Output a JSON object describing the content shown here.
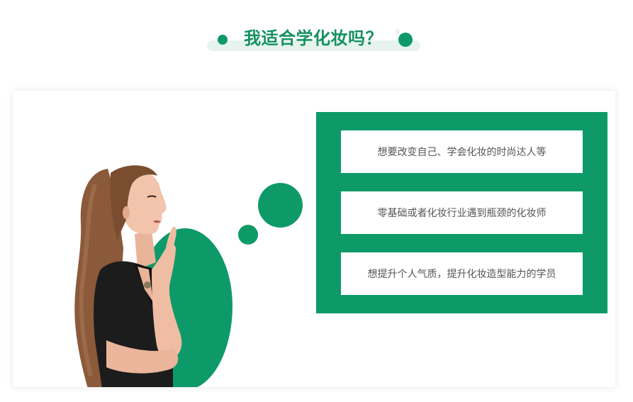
{
  "heading": {
    "title": "我适合学化妆吗？"
  },
  "colors": {
    "accent": "#0e9a68",
    "heading_text": "#14915f",
    "item_text": "#555555",
    "heading_bar": "#e6f3ee"
  },
  "illustration": {
    "person": "woman-thinking-photo",
    "bubbles": [
      "thought-bubble-large",
      "thought-bubble-small"
    ]
  },
  "items": [
    {
      "label": "想要改变自己、学会化妆的时尚达人等"
    },
    {
      "label": "零基础或者化妆行业遇到瓶颈的化妆师"
    },
    {
      "label": "想提升个人气质，提升化妆造型能力的学员"
    }
  ]
}
